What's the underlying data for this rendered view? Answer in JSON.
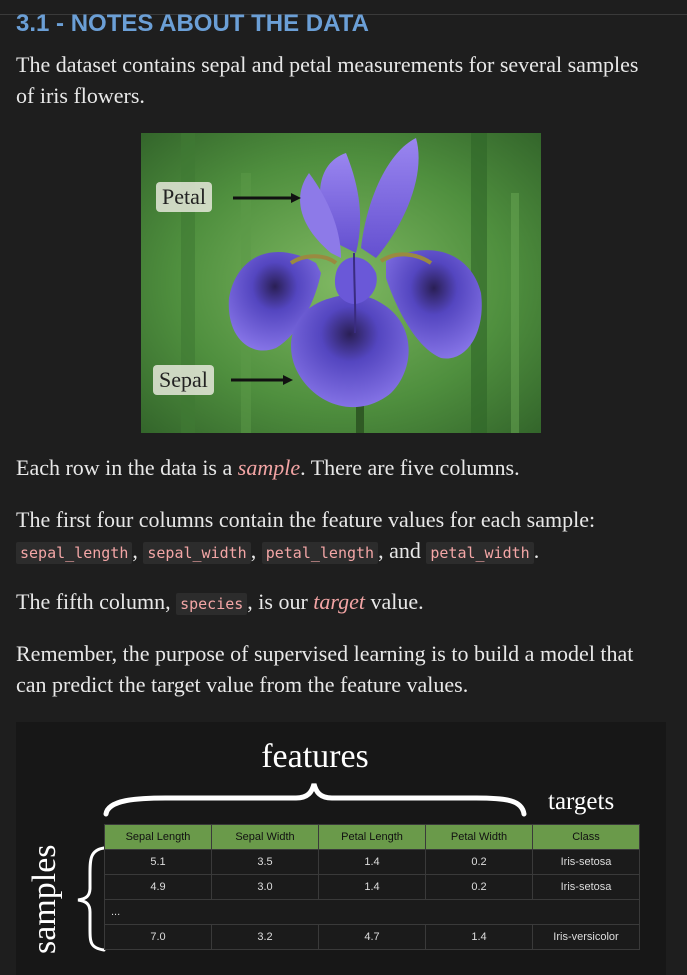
{
  "section": {
    "heading": "3.1 - NOTES ABOUT THE DATA"
  },
  "intro": "The dataset contains sepal and petal measurements for several samples of iris flowers.",
  "figure": {
    "petal_label": "Petal",
    "sepal_label": "Sepal"
  },
  "p_rows": {
    "pre": "Each row in the data is a ",
    "em": "sample",
    "post": ". There are five columns."
  },
  "p_features": {
    "pre": "The first four columns contain the feature values for each sample: ",
    "code1": "sepal_length",
    "sep1": ", ",
    "code2": "sepal_width",
    "sep2": ", ",
    "code3": "petal_length",
    "sep3": ", and ",
    "code4": "petal_width",
    "post": "."
  },
  "p_target": {
    "pre": "The fifth column, ",
    "code": "species",
    "mid": ", is our ",
    "em": "target",
    "post": " value."
  },
  "p_remember": "Remember, the purpose of supervised learning is to build a model that can predict the target value from the feature values.",
  "diagram": {
    "features_label": "features",
    "targets_label": "targets",
    "samples_label": "samples",
    "header_color": "#6a9a4a",
    "columns": [
      "Sepal Length",
      "Sepal Width",
      "Petal Length",
      "Petal Width",
      "Class"
    ],
    "rows": [
      [
        "5.1",
        "3.5",
        "1.4",
        "0.2",
        "Iris-setosa"
      ],
      [
        "4.9",
        "3.0",
        "1.4",
        "0.2",
        "Iris-setosa"
      ],
      [
        "7.0",
        "3.2",
        "4.7",
        "1.4",
        "Iris-versicolor"
      ]
    ],
    "ellipsis": "..."
  }
}
